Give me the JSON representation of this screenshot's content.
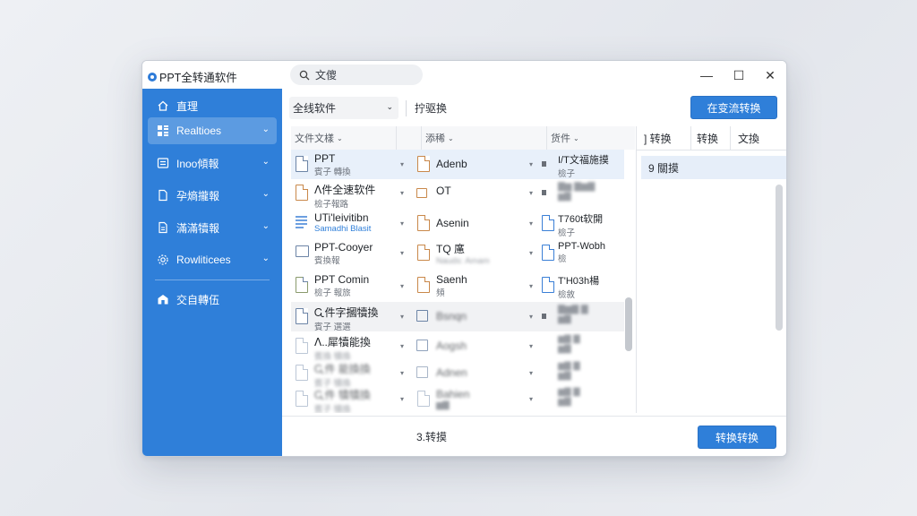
{
  "app": {
    "title": "PPT全转通软件"
  },
  "search": {
    "label": "文傻"
  },
  "window_controls": {
    "minimize": "—",
    "maximize": "☐",
    "close": "✕"
  },
  "sidebar": {
    "items": [
      {
        "label": "直理",
        "icon": "home-icon"
      },
      {
        "label": "Realtioes",
        "icon": "grid-icon",
        "active": true
      },
      {
        "label": "Inoo傾報",
        "icon": "doc-list-icon"
      },
      {
        "label": "孕熵攏報",
        "icon": "file-icon"
      },
      {
        "label": "滿滿犢報",
        "icon": "note-icon"
      },
      {
        "label": "Rowliticees",
        "icon": "gear-icon"
      },
      {
        "label": "交自轉伍",
        "icon": "export-icon"
      }
    ]
  },
  "toolbar": {
    "format_select": "全线软件",
    "label": "拧驱换",
    "action_button": "在变流转换"
  },
  "columns": {
    "name": "文件文樣",
    "target": "添稀",
    "type": "货件"
  },
  "files": [
    {
      "name": "PPT",
      "sub": "賓子 轉換",
      "target": "Adenb",
      "type": "I/T文福施摸",
      "type_sub": "檢子"
    },
    {
      "name": "ᐱ件全速软件",
      "sub": "檢子報路",
      "target": "OT",
      "type": "",
      "type_sub": ""
    },
    {
      "name": "UTi'leivitibn",
      "sub": "Samadhi Blasit",
      "target": "Asenin",
      "type": "T760t软開",
      "type_sub": "檢子"
    },
    {
      "name": "PPT-Cooyer",
      "sub": "賓換報",
      "target": "TQ 㢜",
      "target_sub": "Nauds: Amam",
      "type": "PPT-Wobh",
      "type_sub": "檢"
    },
    {
      "name": "PPT Comin",
      "sub": "檢子 報旅",
      "target": "Saenh",
      "target_sub": "頻",
      "type": "T'H03h楊",
      "type_sub": "檢敘"
    },
    {
      "name": "Ꮹ件字摑犢換",
      "sub": "賓子 選選",
      "target": "Bsnqn",
      "type": "",
      "type_sub": ""
    },
    {
      "name": "ᐱ..犀犢能換",
      "sub": "賓換 犢換",
      "target": "Aogsh",
      "type": "",
      "type_sub": ""
    },
    {
      "name": "Ꮹ件 能換換",
      "sub": "賓子 犢換",
      "target": "Adnen",
      "type": "",
      "type_sub": ""
    },
    {
      "name": "Ꮹ件 犢犢換",
      "sub": "賓子 犢換",
      "target": "Bahien",
      "type": "",
      "type_sub": ""
    }
  ],
  "right_panel": {
    "tabs": [
      "] 转换",
      "转换",
      "文換"
    ],
    "selected": "9 關摸"
  },
  "footer": {
    "status": "3.转摸",
    "convert_button": "转换转换"
  },
  "colors": {
    "accent": "#2f7fd9"
  }
}
